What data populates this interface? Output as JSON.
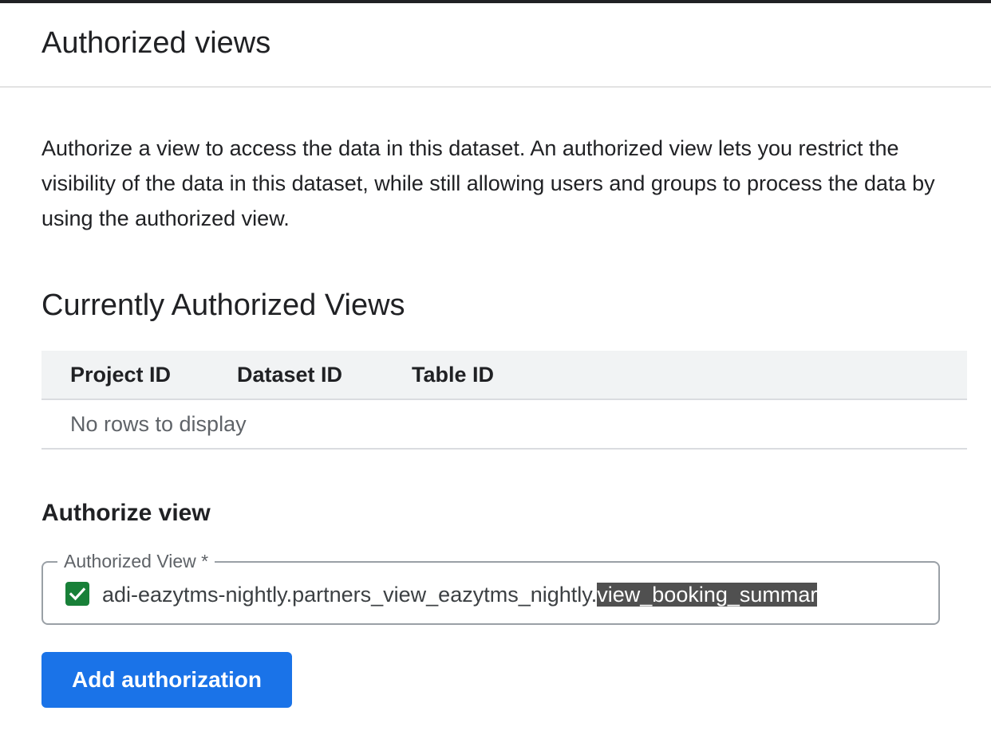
{
  "panel": {
    "title": "Authorized views"
  },
  "description": "Authorize a view to access the data in this dataset. An authorized view lets you restrict the visibility of the data in this dataset, while still allowing users and groups to process the data by using the authorized view.",
  "current_views": {
    "title": "Currently Authorized Views",
    "columns": [
      "Project ID",
      "Dataset ID",
      "Table ID"
    ],
    "rows": [],
    "empty_text": "No rows to display"
  },
  "authorize": {
    "title": "Authorize view",
    "field": {
      "label": "Authorized View *",
      "checked": true,
      "value_prefix": "adi-eazytms-nightly.partners_view_eazytms_nightly.",
      "value_selected": "view_booking_summar"
    },
    "button_label": "Add authorization"
  },
  "colors": {
    "accent": "#1a73e8",
    "checkbox": "#188038",
    "selection": "#505050"
  },
  "icons": {
    "checkbox": "checkmark-icon"
  }
}
